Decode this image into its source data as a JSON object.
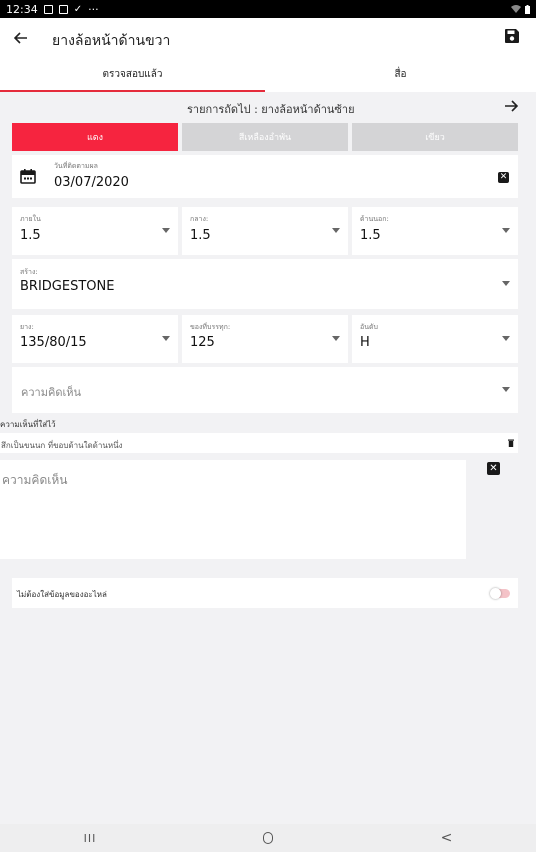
{
  "status_bar": {
    "time": "12:34",
    "overflow": "···"
  },
  "header": {
    "title": "ยางล้อหน้าด้านขวา",
    "back_icon": "arrow-left-icon",
    "save_icon": "floppy-disk-icon"
  },
  "tabs": [
    {
      "label": "ตรวจสอบแล้ว",
      "active": true
    },
    {
      "label": "สื่อ",
      "active": false
    }
  ],
  "next_item": {
    "text": "รายการถัดไป : ยางล้อหน้าด้านซ้าย"
  },
  "status_buttons": [
    {
      "label": "แดง",
      "color": "#f6243f"
    },
    {
      "label": "สีเหลืองอำพัน",
      "color": "#d4d4d6"
    },
    {
      "label": "เขียว",
      "color": "#d4d4d6"
    }
  ],
  "date_field": {
    "label": "วันที่ติดตามผล",
    "value": "03/07/2020",
    "icon": "calendar-icon"
  },
  "tread_fields": [
    {
      "label": "ภายใน",
      "value": "1.5"
    },
    {
      "label": "กลาง:",
      "value": "1.5"
    },
    {
      "label": "ด้านนอก:",
      "value": "1.5"
    }
  ],
  "brand_field": {
    "label": "สร้าง:",
    "value": "BRIDGESTONE"
  },
  "spec_fields": [
    {
      "label": "ยาง:",
      "value": "135/80/15"
    },
    {
      "label": "ของที่บรรทุก:",
      "value": "125"
    },
    {
      "label": "อันดับ",
      "value": "H"
    }
  ],
  "comment_select": {
    "placeholder": "ความคิดเห็น"
  },
  "added_comments": {
    "title": "ความเห็นที่ใส่ไว้",
    "item": "สึกเป็นขนนก ที่ขอบด้านใดด้านหนึ่ง"
  },
  "comment_box": {
    "placeholder": "ความคิดเห็น"
  },
  "no_parts_toggle": {
    "label": "ไม่ต้องใส่ข้อมูลของอะไหล่",
    "on": false
  },
  "nav": {
    "recent": "III",
    "back": "<"
  },
  "colors": {
    "accent": "#e52b3b"
  }
}
